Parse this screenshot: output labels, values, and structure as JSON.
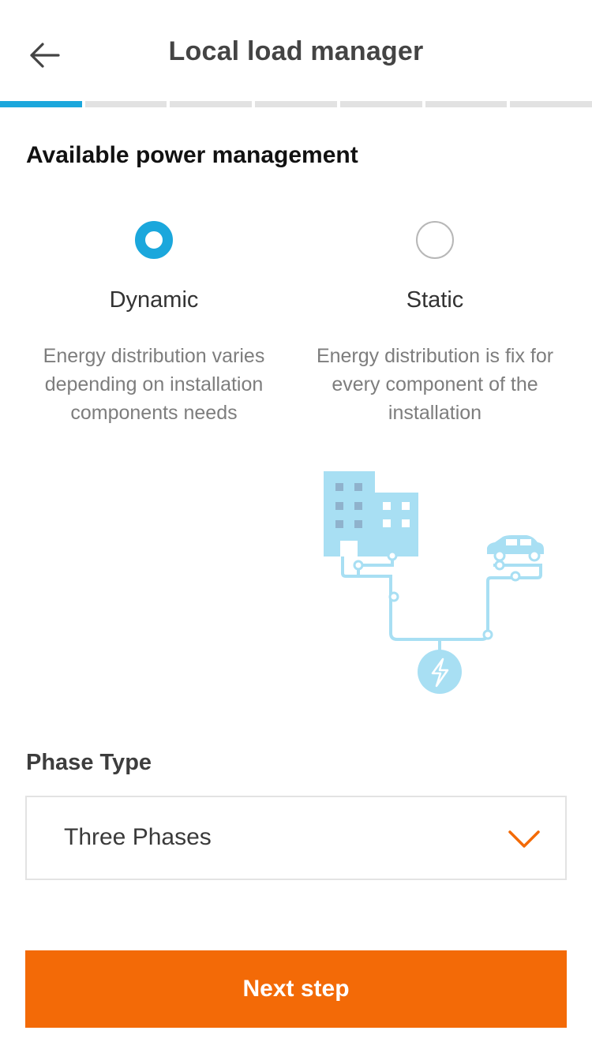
{
  "header": {
    "title": "Local load manager",
    "back_icon": "arrow-left-icon"
  },
  "progress": {
    "total_steps": 7,
    "current_step": 1,
    "active_color": "#1ba7dc",
    "inactive_color": "#e2e2e2"
  },
  "power_management": {
    "heading": "Available power management",
    "selected": "dynamic",
    "options": [
      {
        "id": "dynamic",
        "label": "Dynamic",
        "description": "Energy distribution varies depending on installation components needs",
        "checked": true
      },
      {
        "id": "static",
        "label": "Static",
        "description": "Energy distribution is fix for every component of the installation",
        "checked": false
      }
    ],
    "illustration_icon": "building-car-grid-icon"
  },
  "phase_type": {
    "label": "Phase Type",
    "selected_value": "Three Phases",
    "dropdown_icon": "chevron-down-icon"
  },
  "footer": {
    "next_label": "Next step"
  },
  "colors": {
    "accent_blue": "#1ba7dc",
    "primary_orange": "#f36a07",
    "illustration_blue": "#a8dff3"
  }
}
